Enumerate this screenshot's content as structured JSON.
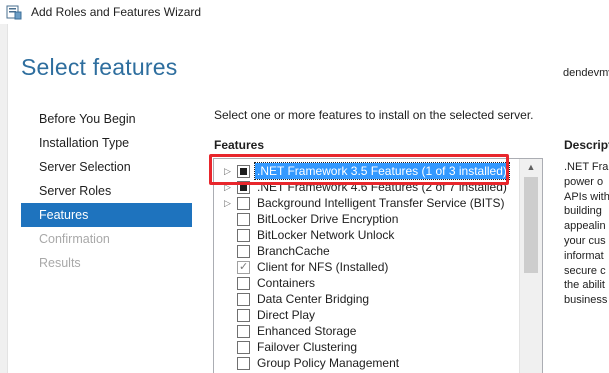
{
  "window": {
    "title": "Add Roles and Features Wizard",
    "icon": "server-manager-icon"
  },
  "header": {
    "page_title": "Select features",
    "server_name": "dendevmv"
  },
  "nav": {
    "items": [
      {
        "label": "Before You Begin",
        "state": "normal"
      },
      {
        "label": "Installation Type",
        "state": "normal"
      },
      {
        "label": "Server Selection",
        "state": "normal"
      },
      {
        "label": "Server Roles",
        "state": "normal"
      },
      {
        "label": "Features",
        "state": "active"
      },
      {
        "label": "Confirmation",
        "state": "disabled"
      },
      {
        "label": "Results",
        "state": "disabled"
      }
    ]
  },
  "main": {
    "instruction": "Select one or more features to install on the selected server.",
    "features_heading": "Features",
    "features": [
      {
        "label": ".NET Framework 3.5 Features (1 of 3 installed)",
        "expandable": true,
        "check": "partial",
        "selected": true
      },
      {
        "label": ".NET Framework 4.6 Features (2 of 7 installed)",
        "expandable": true,
        "check": "partial",
        "selected": false
      },
      {
        "label": "Background Intelligent Transfer Service (BITS)",
        "expandable": true,
        "check": "none",
        "selected": false
      },
      {
        "label": "BitLocker Drive Encryption",
        "expandable": false,
        "check": "none",
        "selected": false
      },
      {
        "label": "BitLocker Network Unlock",
        "expandable": false,
        "check": "none",
        "selected": false
      },
      {
        "label": "BranchCache",
        "expandable": false,
        "check": "none",
        "selected": false
      },
      {
        "label": "Client for NFS (Installed)",
        "expandable": false,
        "check": "checked",
        "selected": false
      },
      {
        "label": "Containers",
        "expandable": false,
        "check": "none",
        "selected": false
      },
      {
        "label": "Data Center Bridging",
        "expandable": false,
        "check": "none",
        "selected": false
      },
      {
        "label": "Direct Play",
        "expandable": false,
        "check": "none",
        "selected": false
      },
      {
        "label": "Enhanced Storage",
        "expandable": false,
        "check": "none",
        "selected": false
      },
      {
        "label": "Failover Clustering",
        "expandable": false,
        "check": "none",
        "selected": false
      },
      {
        "label": "Group Policy Management",
        "expandable": false,
        "check": "none",
        "selected": false
      }
    ]
  },
  "description": {
    "heading": "Descript",
    "lines": [
      ".NET Fra",
      "power o",
      "APIs with",
      "building",
      "appealin",
      "your cus",
      "informat",
      "secure c",
      "the abilit",
      "business"
    ]
  },
  "colors": {
    "accent": "#1e73be",
    "title": "#2e6e9e",
    "selection": "#3399ff",
    "highlight_border": "#e8262c"
  }
}
